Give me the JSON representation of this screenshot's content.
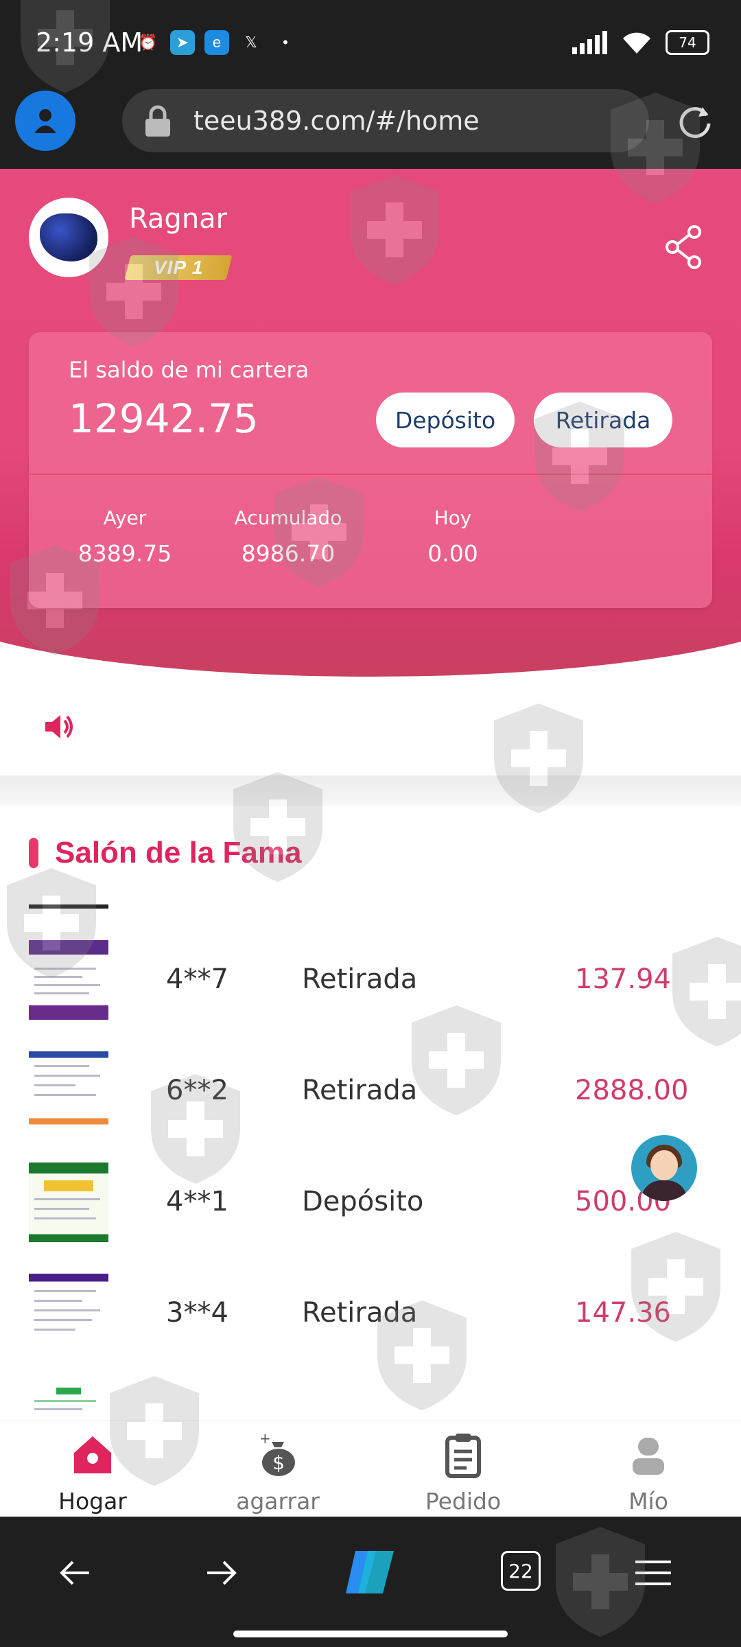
{
  "status_bar": {
    "time": "2:19 AM",
    "battery": "74"
  },
  "browser": {
    "url": "teeu389.com/#/home"
  },
  "profile": {
    "name": "Ragnar",
    "vip": "VIP 1"
  },
  "wallet": {
    "label": "El saldo de mi cartera",
    "balance": "12942.75",
    "deposit_label": "Depósito",
    "withdraw_label": "Retirada",
    "stats": [
      {
        "label": "Ayer",
        "value": "8389.75"
      },
      {
        "label": "Acumulado",
        "value": "8986.70"
      },
      {
        "label": "Hoy",
        "value": "0.00"
      }
    ]
  },
  "hall_of_fame": {
    "title": "Salón de la Fama",
    "rows": [
      {
        "user": "4**7",
        "type": "Retirada",
        "amount": "137.94"
      },
      {
        "user": "6**2",
        "type": "Retirada",
        "amount": "2888.00"
      },
      {
        "user": "4**1",
        "type": "Depósito",
        "amount": "500.00"
      },
      {
        "user": "3**4",
        "type": "Retirada",
        "amount": "147.36"
      }
    ]
  },
  "tabs": [
    {
      "label": "Hogar",
      "icon": "home-icon",
      "active": true
    },
    {
      "label": "agarrar",
      "icon": "money-bag-icon",
      "active": false
    },
    {
      "label": "Pedido",
      "icon": "clipboard-icon",
      "active": false
    },
    {
      "label": "Mío",
      "icon": "user-icon",
      "active": false
    }
  ],
  "system_nav": {
    "tab_count": "22"
  },
  "colors": {
    "accent": "#e4497a",
    "brand_text": "#e0245e",
    "amount": "#d03b6a"
  }
}
